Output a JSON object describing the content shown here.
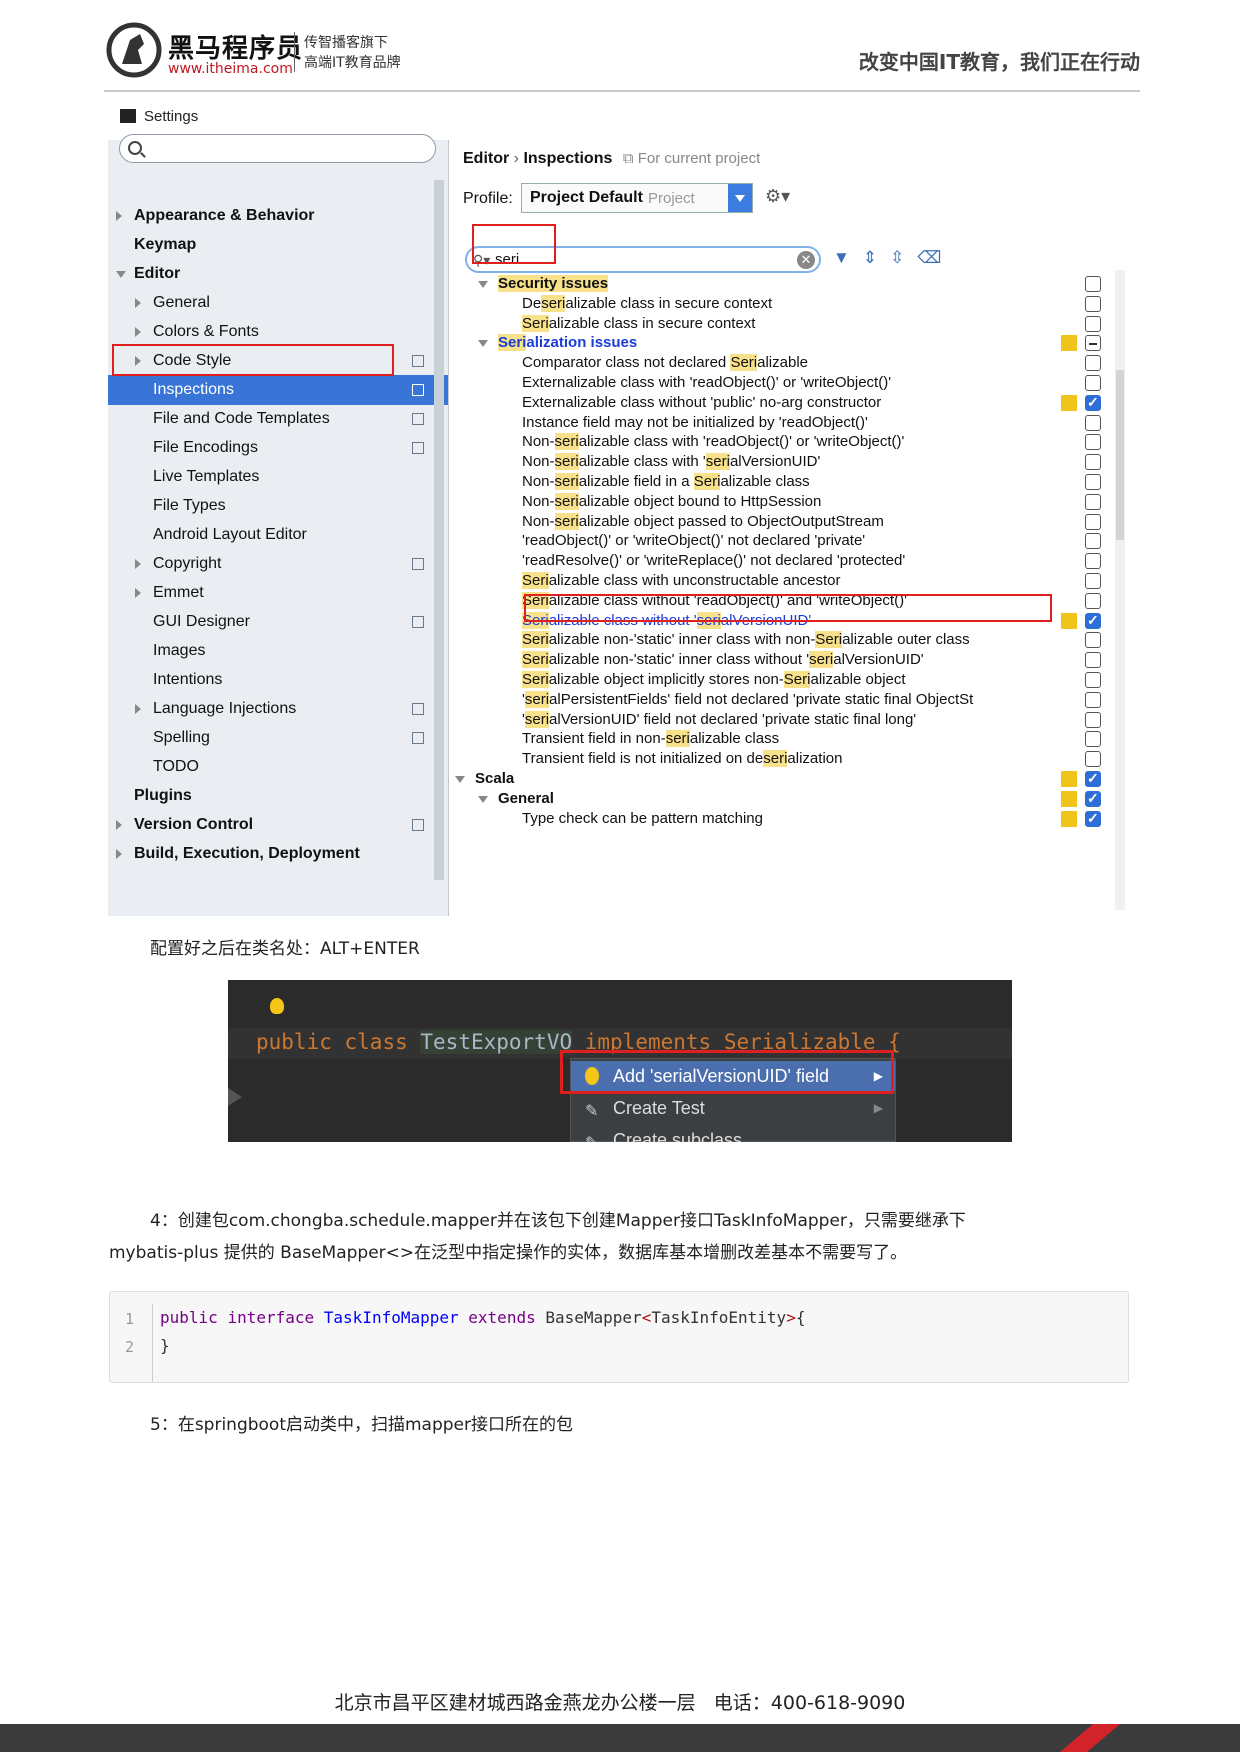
{
  "header": {
    "brand_name": "黑马程序员",
    "brand_url": "www.itheima.com",
    "tagline_1": "传智播客旗下",
    "tagline_2": "高端IT教育品牌",
    "slogan": "改变中国IT教育，我们正在行动"
  },
  "settings": {
    "window_title": "Settings",
    "tree": [
      {
        "label": "Appearance & Behavior",
        "level": 0,
        "bold": true,
        "arrow": "right"
      },
      {
        "label": "Keymap",
        "level": 0,
        "bold": true,
        "arrow": "none"
      },
      {
        "label": "Editor",
        "level": 0,
        "bold": true,
        "arrow": "down"
      },
      {
        "label": "General",
        "level": 1,
        "arrow": "right"
      },
      {
        "label": "Colors & Fonts",
        "level": 1,
        "arrow": "right"
      },
      {
        "label": "Code Style",
        "level": 1,
        "arrow": "right",
        "project": true
      },
      {
        "label": "Inspections",
        "level": 1,
        "arrow": "none",
        "project": true,
        "selected": true
      },
      {
        "label": "File and Code Templates",
        "level": 1,
        "arrow": "none",
        "project": true
      },
      {
        "label": "File Encodings",
        "level": 1,
        "arrow": "none",
        "project": true
      },
      {
        "label": "Live Templates",
        "level": 1,
        "arrow": "none"
      },
      {
        "label": "File Types",
        "level": 1,
        "arrow": "none"
      },
      {
        "label": "Android Layout Editor",
        "level": 1,
        "arrow": "none"
      },
      {
        "label": "Copyright",
        "level": 1,
        "arrow": "right",
        "project": true
      },
      {
        "label": "Emmet",
        "level": 1,
        "arrow": "right"
      },
      {
        "label": "GUI Designer",
        "level": 1,
        "arrow": "none",
        "project": true
      },
      {
        "label": "Images",
        "level": 1,
        "arrow": "none"
      },
      {
        "label": "Intentions",
        "level": 1,
        "arrow": "none"
      },
      {
        "label": "Language Injections",
        "level": 1,
        "arrow": "right",
        "project": true
      },
      {
        "label": "Spelling",
        "level": 1,
        "arrow": "none",
        "project": true
      },
      {
        "label": "TODO",
        "level": 1,
        "arrow": "none"
      },
      {
        "label": "Plugins",
        "level": 0,
        "bold": true,
        "arrow": "none"
      },
      {
        "label": "Version Control",
        "level": 0,
        "bold": true,
        "arrow": "right",
        "project": true
      },
      {
        "label": "Build, Execution, Deployment",
        "level": 0,
        "bold": true,
        "arrow": "right"
      }
    ],
    "breadcrumb": {
      "part1": "Editor",
      "sep": "›",
      "part2": "Inspections",
      "scope": "For current project"
    },
    "profile": {
      "label": "Profile:",
      "value": "Project Default",
      "scope": "Project"
    },
    "filter_text": "seri",
    "inspections": [
      {
        "segments": [
          "",
          "Security issues"
        ],
        "level": 1,
        "group": true,
        "check": "off"
      },
      {
        "segments": [
          "De",
          "seri",
          "alizable class in secure context"
        ],
        "level": 2,
        "check": "off"
      },
      {
        "segments": [
          "",
          "Seri",
          "alizable class in secure context"
        ],
        "level": 2,
        "check": "off"
      },
      {
        "segments": [
          "",
          "Seri",
          "alization issues"
        ],
        "level": 1,
        "group": true,
        "blue": true,
        "sev": true,
        "check": "mixed"
      },
      {
        "segments": [
          "Comparator class not declared ",
          "Seri",
          "alizable"
        ],
        "level": 2,
        "check": "off"
      },
      {
        "segments": [
          "Externalizable class with 'readObject()' or 'writeObject()'"
        ],
        "level": 2,
        "check": "off"
      },
      {
        "segments": [
          "Externalizable class without 'public' no-arg constructor"
        ],
        "level": 2,
        "sev": true,
        "check": "on"
      },
      {
        "segments": [
          "Instance field may not be initialized by 'readObject()'"
        ],
        "level": 2,
        "check": "off"
      },
      {
        "segments": [
          "Non-",
          "seri",
          "alizable class with 'readObject()' or 'writeObject()'"
        ],
        "level": 2,
        "check": "off"
      },
      {
        "segments": [
          "Non-",
          "seri",
          "alizable class with '",
          "seri",
          "alVersionUID'"
        ],
        "level": 2,
        "check": "off"
      },
      {
        "segments": [
          "Non-",
          "seri",
          "alizable field in a ",
          "Seri",
          "alizable class"
        ],
        "level": 2,
        "check": "off"
      },
      {
        "segments": [
          "Non-",
          "seri",
          "alizable object bound to HttpSession"
        ],
        "level": 2,
        "check": "off"
      },
      {
        "segments": [
          "Non-",
          "seri",
          "alizable object passed to ObjectOutputStream"
        ],
        "level": 2,
        "check": "off"
      },
      {
        "segments": [
          "'readObject()' or 'writeObject()' not declared 'private'"
        ],
        "level": 2,
        "check": "off"
      },
      {
        "segments": [
          "'readResolve()' or 'writeReplace()' not declared 'protected'"
        ],
        "level": 2,
        "check": "off"
      },
      {
        "segments": [
          "",
          "Seri",
          "alizable class with unconstructable ancestor"
        ],
        "level": 2,
        "check": "off"
      },
      {
        "segments": [
          "",
          "Seri",
          "alizable class without 'readObject()' and 'writeObject()'"
        ],
        "level": 2,
        "check": "off"
      },
      {
        "segments": [
          "",
          "Seri",
          "alizable class without '",
          "seri",
          "alVersionUID'"
        ],
        "level": 2,
        "blue": true,
        "sev": true,
        "check": "on",
        "boxed": true
      },
      {
        "segments": [
          "",
          "Seri",
          "alizable non-'static' inner class with non-",
          "Seri",
          "alizable outer class"
        ],
        "level": 2,
        "check": "off"
      },
      {
        "segments": [
          "",
          "Seri",
          "alizable non-'static' inner class without '",
          "seri",
          "alVersionUID'"
        ],
        "level": 2,
        "check": "off"
      },
      {
        "segments": [
          "",
          "Seri",
          "alizable object implicitly stores non-",
          "Seri",
          "alizable object"
        ],
        "level": 2,
        "check": "off"
      },
      {
        "segments": [
          "'",
          "seri",
          "alPersistentFields' field not declared 'private static final ObjectSt"
        ],
        "level": 2,
        "check": "off"
      },
      {
        "segments": [
          "'",
          "seri",
          "alVersionUID' field not declared 'private static final long'"
        ],
        "level": 2,
        "check": "off"
      },
      {
        "segments": [
          "Transient field in non-",
          "seri",
          "alizable class"
        ],
        "level": 2,
        "check": "off"
      },
      {
        "segments": [
          "Transient field is not initialized on de",
          "seri",
          "alization"
        ],
        "level": 2,
        "check": "off"
      },
      {
        "segments": [
          "Scala"
        ],
        "level": 0,
        "group": true,
        "sev": true,
        "check": "on"
      },
      {
        "segments": [
          "General"
        ],
        "level": 1,
        "group": true,
        "sev": true,
        "check": "on"
      },
      {
        "segments": [
          "Type check can be pattern matching"
        ],
        "level": 2,
        "sev": true,
        "check": "on"
      }
    ]
  },
  "step3_note": "配置好之后在类名处：ALT+ENTER",
  "editor": {
    "kw1": "public",
    "kw2": "class",
    "classname": "TestExportVO",
    "rest": " implements Serializable {",
    "menu": [
      {
        "label": "Add 'serialVersionUID' field",
        "selected": true
      },
      {
        "label": "Create Test",
        "selected": false
      },
      {
        "label": "Create subclass",
        "selected": false
      }
    ]
  },
  "step4_line1": "4：创建包com.chongba.schedule.mapper并在该包下创建Mapper接口TaskInfoMapper，只需要继承下",
  "step4_line2": "mybatis-plus 提供的 BaseMapper<>在泛型中指定操作的实体，数据库基本增删改差基本不需要写了。",
  "code": {
    "line_numbers": [
      "1",
      "2"
    ],
    "line1_kw1": "public",
    "line1_kw2": "interface",
    "line1_name": "TaskInfoMapper",
    "line1_kw3": "extends",
    "line1_base": "BaseMapper",
    "line1_lt": "<",
    "line1_generic": "TaskInfoEntity",
    "line1_gt": ">",
    "line1_brace": "{",
    "line2": "}"
  },
  "step5": "5：在springboot启动类中，扫描mapper接口所在的包",
  "footer": {
    "address": "北京市昌平区建材城西路金燕龙办公楼一层",
    "phone_label": "电话：",
    "phone": "400-618-9090"
  },
  "colors": {
    "accent_red": "#d2232a",
    "selection_blue": "#3875d7",
    "highlight": "#f7e18a"
  }
}
